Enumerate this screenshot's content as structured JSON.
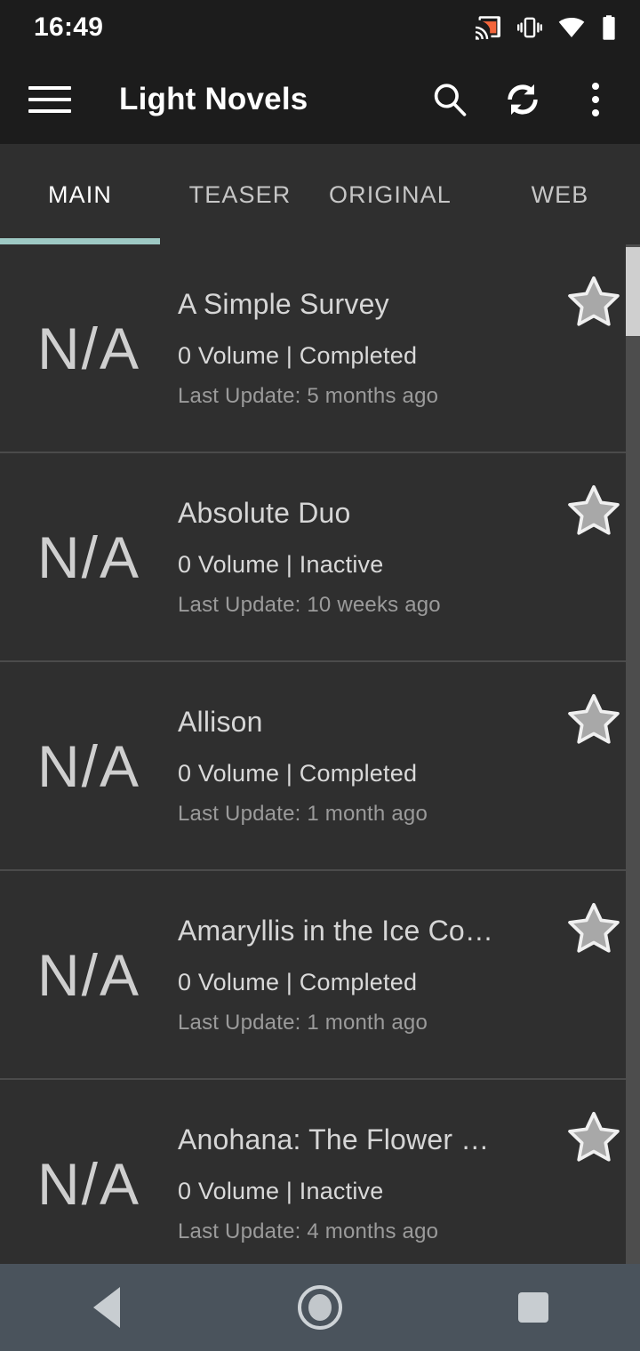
{
  "status_bar": {
    "time": "16:49",
    "icons": [
      "cast-icon",
      "vibrate-icon",
      "wifi-icon",
      "battery-icon"
    ],
    "cast_color": "#f4663c"
  },
  "app_bar": {
    "menu_icon": "hamburger-menu-icon",
    "title": "Light Novels",
    "actions": [
      {
        "name": "search-icon",
        "label": "Search"
      },
      {
        "name": "refresh-icon",
        "label": "Refresh"
      },
      {
        "name": "overflow-menu-icon",
        "label": "More options"
      }
    ]
  },
  "tabs": {
    "active_index": 0,
    "indicator_color": "#9ec9c4",
    "items": [
      {
        "label": "MAIN"
      },
      {
        "label": "TEASER"
      },
      {
        "label": "ORIGINAL"
      },
      {
        "label": "WEB"
      }
    ]
  },
  "list": {
    "thumb_placeholder": "N/A",
    "items": [
      {
        "title": "A Simple Survey",
        "meta": "0 Volume | Completed",
        "update": "Last Update: 5 months ago",
        "favorite_icon": "star-icon"
      },
      {
        "title": "Absolute Duo",
        "meta": "0 Volume | Inactive",
        "update": "Last Update: 10 weeks ago",
        "favorite_icon": "star-icon"
      },
      {
        "title": "Allison",
        "meta": "0 Volume | Completed",
        "update": "Last Update: 1 month ago",
        "favorite_icon": "star-icon"
      },
      {
        "title": "Amaryllis in the Ice Co…",
        "meta": "0 Volume | Completed",
        "update": "Last Update: 1 month ago",
        "favorite_icon": "star-icon"
      },
      {
        "title": "Anohana: The Flower …",
        "meta": "0 Volume | Inactive",
        "update": "Last Update: 4 months ago",
        "favorite_icon": "star-icon"
      }
    ]
  },
  "nav_bar": {
    "buttons": [
      {
        "name": "nav-back-button",
        "label": "Back"
      },
      {
        "name": "nav-home-button",
        "label": "Home"
      },
      {
        "name": "nav-recents-button",
        "label": "Recents"
      }
    ]
  },
  "colors": {
    "app_bar_bg": "#1c1c1c",
    "content_bg": "#2f2f2f",
    "divider": "#4b4b4b",
    "nav_bar_bg": "#4a535c",
    "scrollbar_thumb": "#cfcfcf",
    "scrollbar_track": "#4d4d4d"
  }
}
